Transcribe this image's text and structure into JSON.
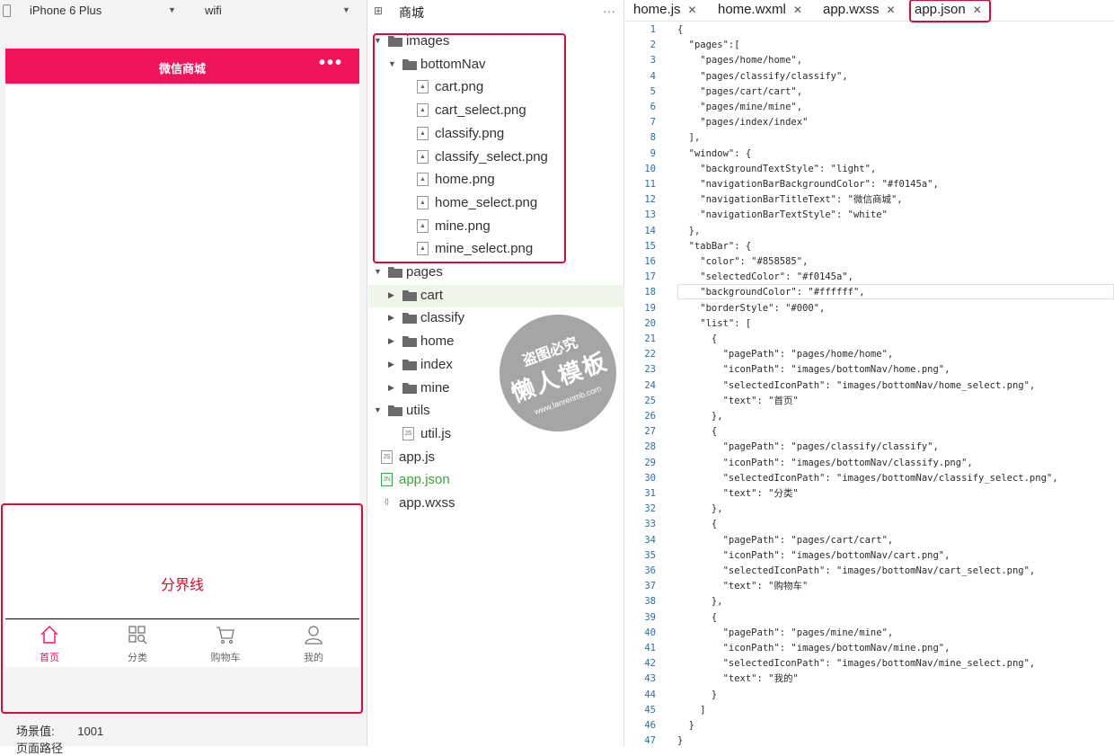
{
  "simulator": {
    "device": "iPhone 6 Plus",
    "network": "wifi",
    "nav_title": "微信商城",
    "nav_more": "•••",
    "divider_text": "分界线",
    "tabs": [
      {
        "label": "首页",
        "icon": "home-icon",
        "active": true
      },
      {
        "label": "分类",
        "icon": "classify-icon",
        "active": false
      },
      {
        "label": "购物车",
        "icon": "cart-icon",
        "active": false
      },
      {
        "label": "我的",
        "icon": "user-icon",
        "active": false
      }
    ],
    "scene_label": "场景值:",
    "scene_value": "1001",
    "page_path_label": "页面路径"
  },
  "filetree": {
    "title": "商城",
    "more": "···",
    "items": [
      {
        "label": "images",
        "type": "folder",
        "open": true
      },
      {
        "label": "bottomNav",
        "type": "folder",
        "open": true
      },
      {
        "label": "cart.png",
        "type": "image"
      },
      {
        "label": "cart_select.png",
        "type": "image"
      },
      {
        "label": "classify.png",
        "type": "image"
      },
      {
        "label": "classify_select.png",
        "type": "image"
      },
      {
        "label": "home.png",
        "type": "image"
      },
      {
        "label": "home_select.png",
        "type": "image"
      },
      {
        "label": "mine.png",
        "type": "image"
      },
      {
        "label": "mine_select.png",
        "type": "image"
      },
      {
        "label": "pages",
        "type": "folder",
        "open": true
      },
      {
        "label": "cart",
        "type": "folder",
        "open": false
      },
      {
        "label": "classify",
        "type": "folder",
        "open": false
      },
      {
        "label": "home",
        "type": "folder",
        "open": false
      },
      {
        "label": "index",
        "type": "folder",
        "open": false
      },
      {
        "label": "mine",
        "type": "folder",
        "open": false
      },
      {
        "label": "utils",
        "type": "folder",
        "open": true
      },
      {
        "label": "util.js",
        "type": "js"
      },
      {
        "label": "app.js",
        "type": "js"
      },
      {
        "label": "app.json",
        "type": "json"
      },
      {
        "label": "app.wxss",
        "type": "wxss"
      }
    ]
  },
  "editor": {
    "tabs": [
      "home.js",
      "home.wxml",
      "app.wxss",
      "app.json"
    ],
    "active_tab": "app.json",
    "lines": [
      "{",
      "  \"pages\":[",
      "    \"pages/home/home\",",
      "    \"pages/classify/classify\",",
      "    \"pages/cart/cart\",",
      "    \"pages/mine/mine\",",
      "    \"pages/index/index\"",
      "  ],",
      "  \"window\": {",
      "    \"backgroundTextStyle\": \"light\",",
      "    \"navigationBarBackgroundColor\": \"#f0145a\",",
      "    \"navigationBarTitleText\": \"微信商城\",",
      "    \"navigationBarTextStyle\": \"white\"",
      "  },",
      "  \"tabBar\": {",
      "    \"color\": \"#858585\",",
      "    \"selectedColor\": \"#f0145a\",",
      "    \"backgroundColor\": \"#ffffff\",",
      "    \"borderStyle\": \"#000\",",
      "    \"list\": [",
      "      {",
      "        \"pagePath\": \"pages/home/home\",",
      "        \"iconPath\": \"images/bottomNav/home.png\",",
      "        \"selectedIconPath\": \"images/bottomNav/home_select.png\",",
      "        \"text\": \"首页\"",
      "      },",
      "      {",
      "        \"pagePath\": \"pages/classify/classify\",",
      "        \"iconPath\": \"images/bottomNav/classify.png\",",
      "        \"selectedIconPath\": \"images/bottomNav/classify_select.png\",",
      "        \"text\": \"分类\"",
      "      },",
      "      {",
      "        \"pagePath\": \"pages/cart/cart\",",
      "        \"iconPath\": \"images/bottomNav/cart.png\",",
      "        \"selectedIconPath\": \"images/bottomNav/cart_select.png\",",
      "        \"text\": \"购物车\"",
      "      },",
      "      {",
      "        \"pagePath\": \"pages/mine/mine\",",
      "        \"iconPath\": \"images/bottomNav/mine.png\",",
      "        \"selectedIconPath\": \"images/bottomNav/mine_select.png\",",
      "        \"text\": \"我的\"",
      "      }",
      "    ]",
      "  }",
      "}"
    ]
  },
  "watermark": {
    "line1": "盗图必究",
    "line2": "懒人模板",
    "line3": "www.lanrenmb.com"
  },
  "colors": {
    "accent": "#f0145a",
    "highlight_box": "#d0103a",
    "line_number": "#2a6ea8"
  }
}
